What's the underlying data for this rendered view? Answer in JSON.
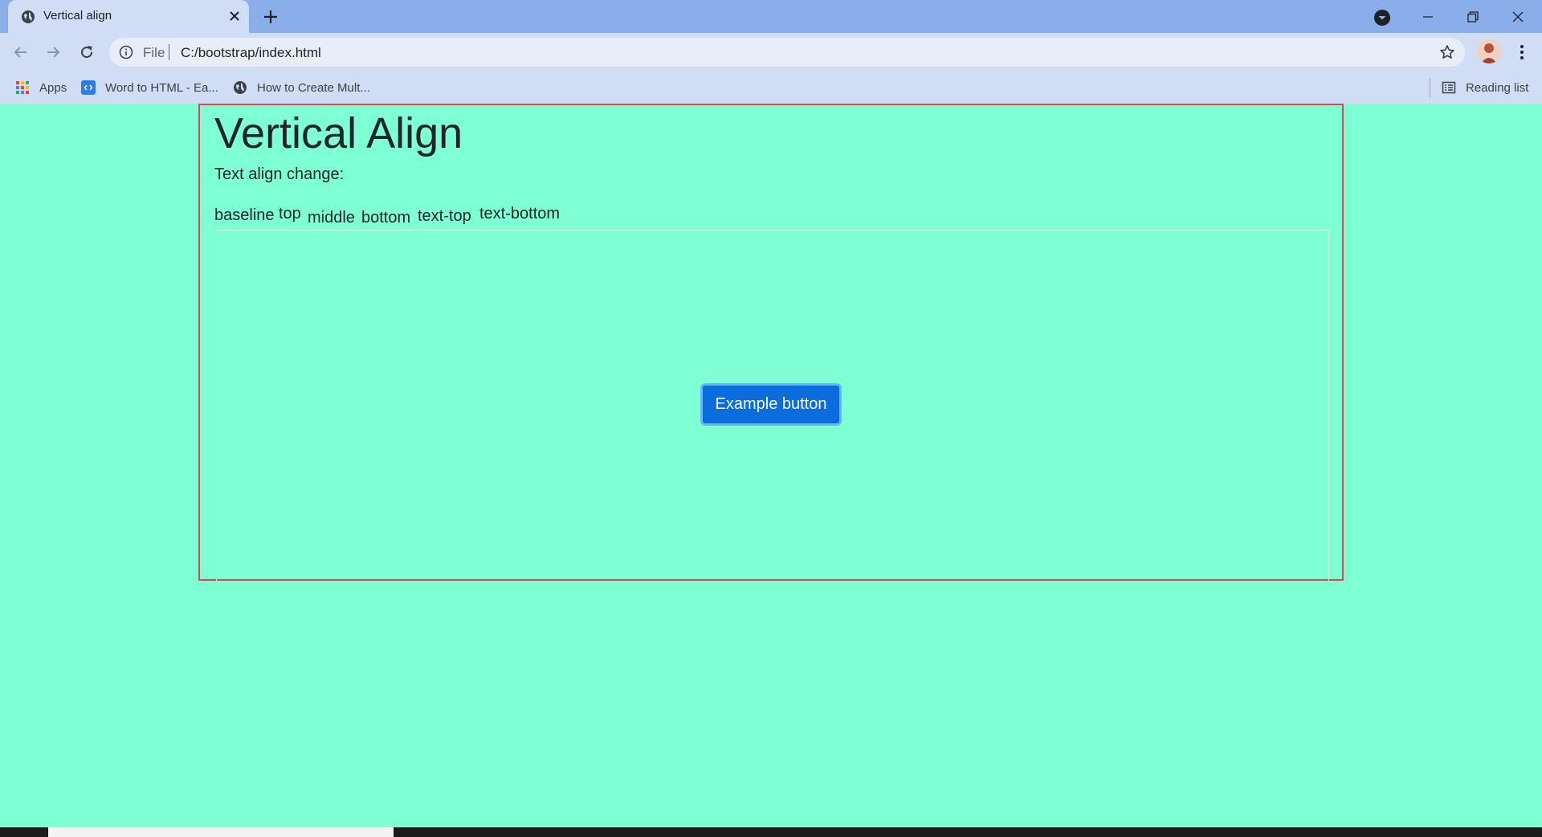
{
  "browser": {
    "tab": {
      "title": "Vertical align",
      "icon": "globe-icon"
    },
    "address_bar": {
      "scheme_label": "File",
      "url": "C:/bootstrap/index.html"
    },
    "bookmarks": [
      {
        "label": "Apps",
        "icon": "apps-grid-icon"
      },
      {
        "label": "Word to HTML - Ea...",
        "icon": "code-icon"
      },
      {
        "label": "How to Create Mult...",
        "icon": "globe-icon"
      }
    ],
    "reading_list": {
      "label": "Reading list",
      "icon": "reading-list-icon"
    }
  },
  "page": {
    "heading": "Vertical Align",
    "subtext": "Text align change:",
    "align_words": [
      "baseline",
      "top",
      "middle",
      "bottom",
      "text-top",
      "text-bottom"
    ],
    "button_label": "Example button"
  },
  "colors": {
    "page_background": "#7fffd4",
    "container_border": "#e0455a",
    "button_background": "#0b6cde",
    "tab_strip": "#8aaee9",
    "toolbar": "#d0ddf5"
  }
}
